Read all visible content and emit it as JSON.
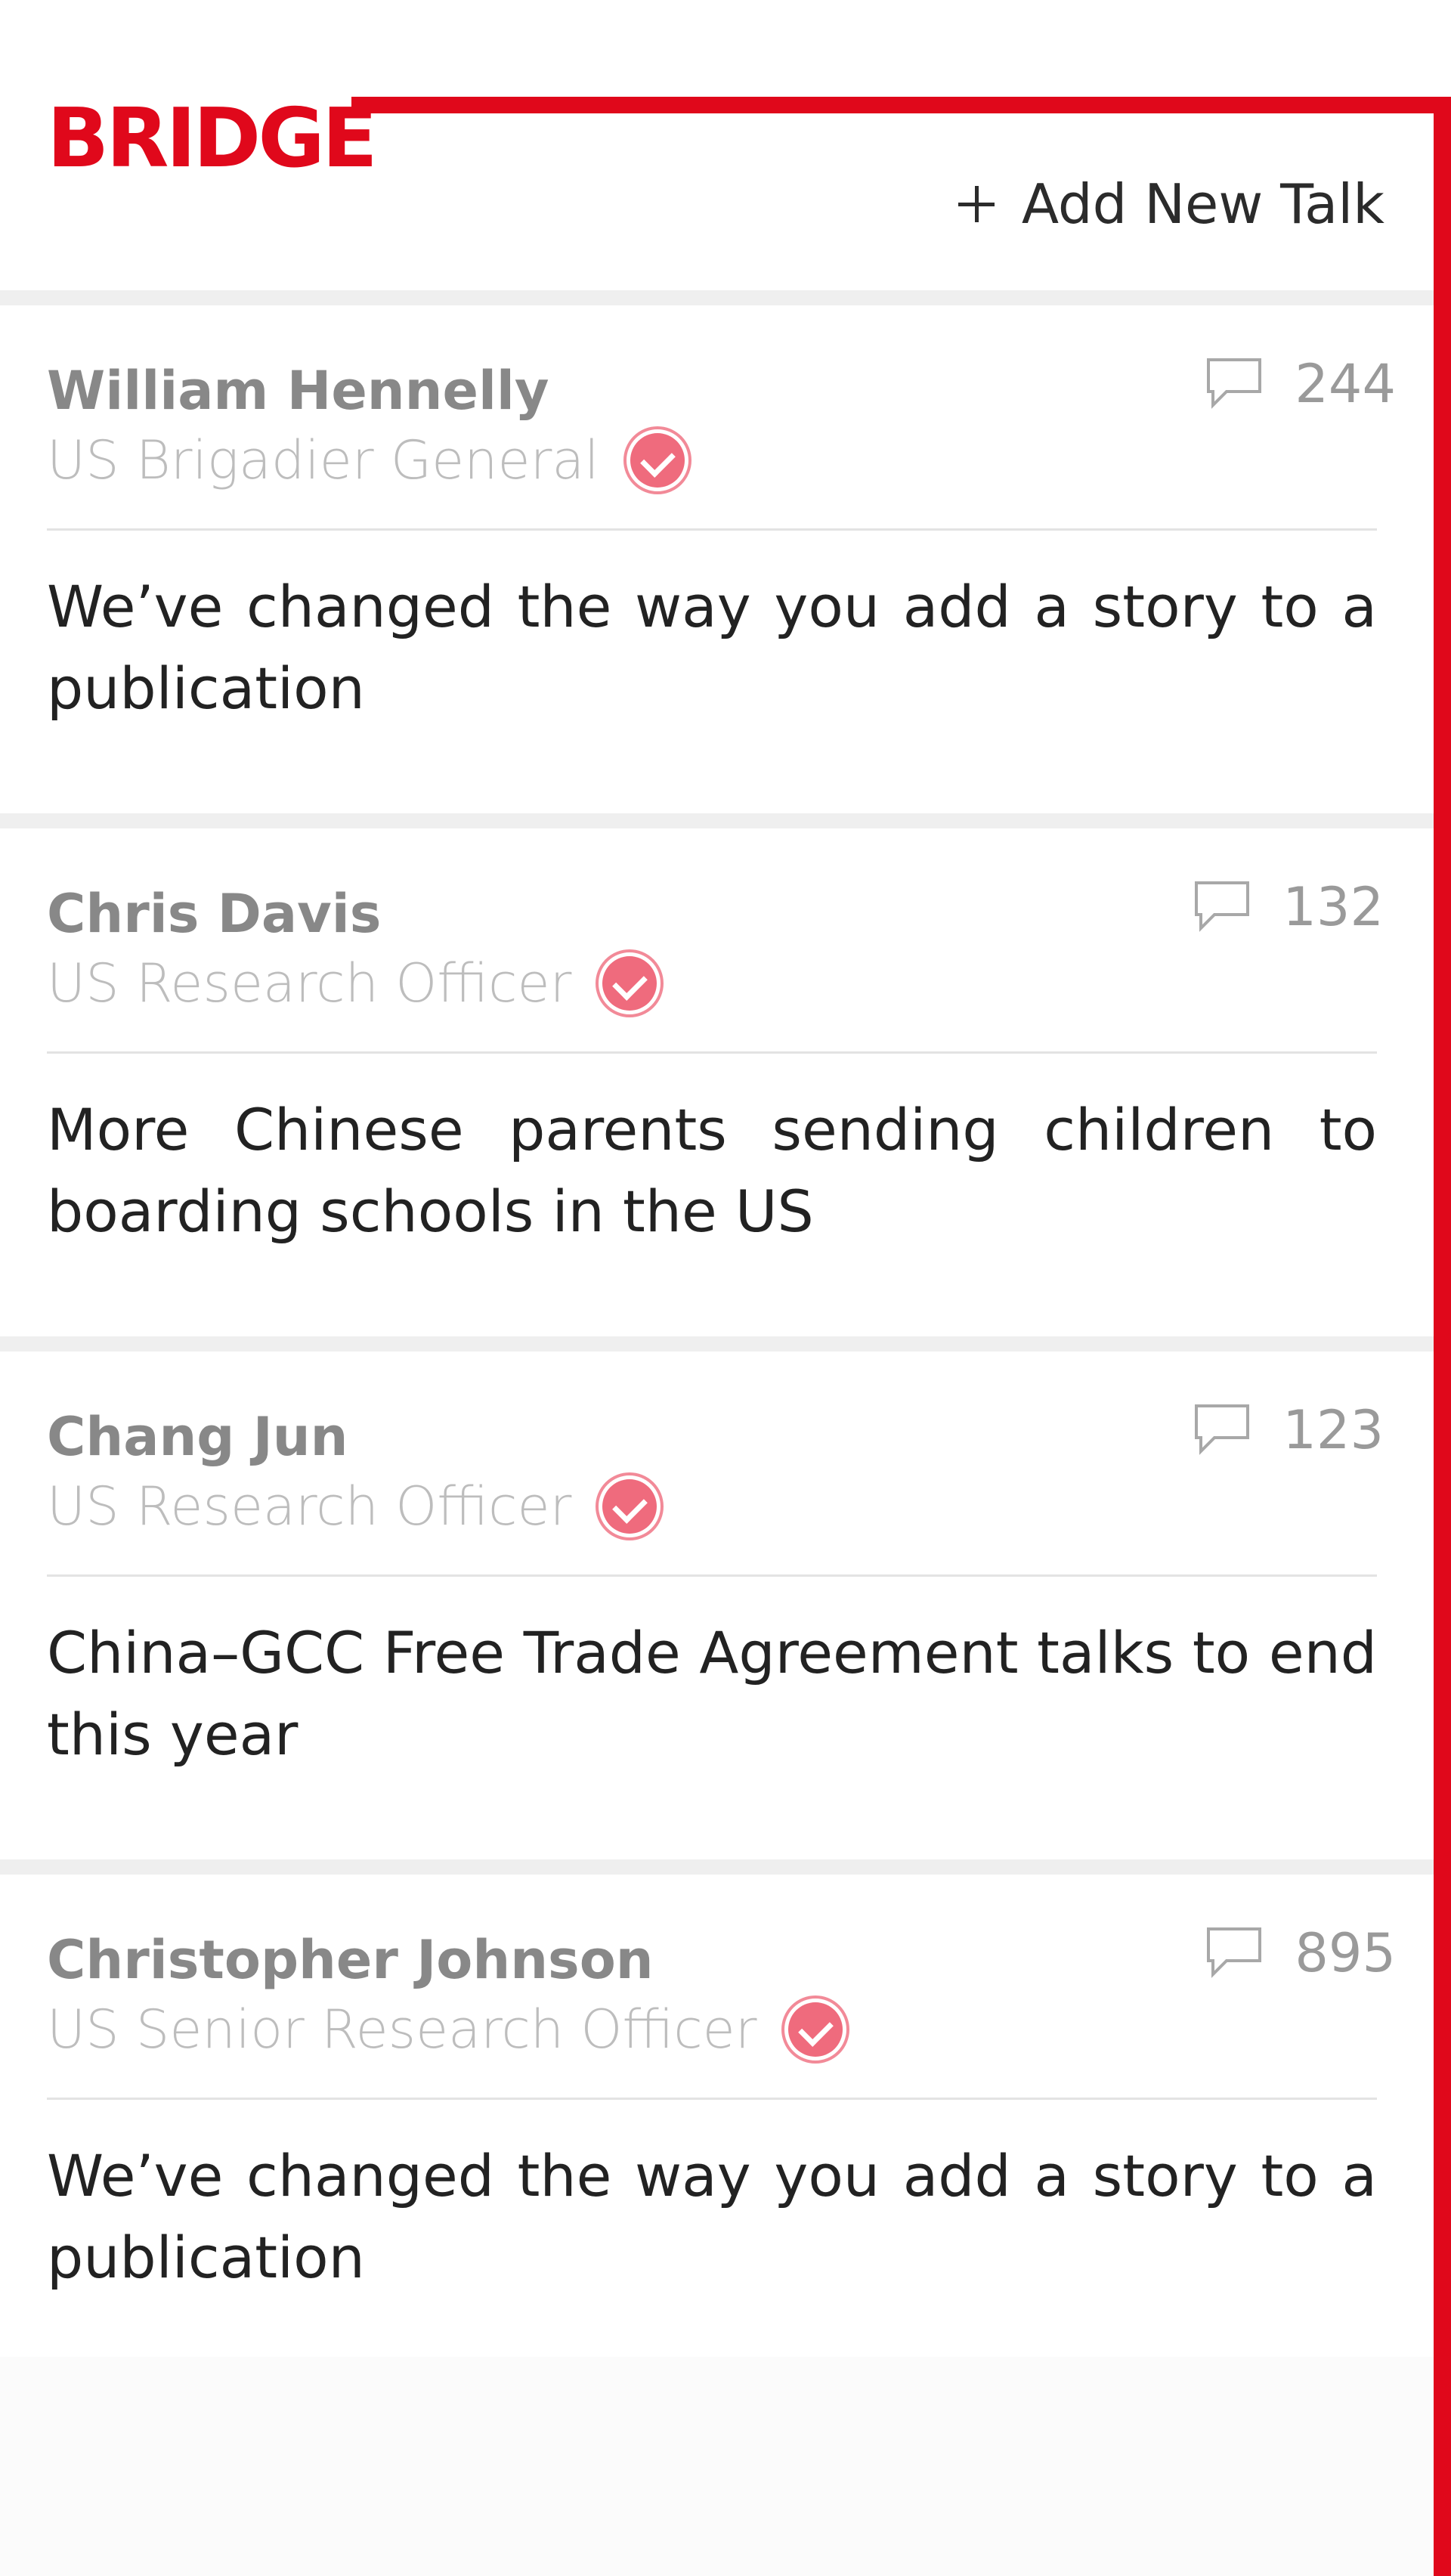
{
  "brand": "BRIDGE",
  "add_button_label": "Add New Talk",
  "colors": {
    "accent": "#E0081B",
    "verified": "#EF6B7D"
  },
  "talks": [
    {
      "author": "William Hennelly",
      "role": "US Brigadier General",
      "verified": true,
      "comments": "244",
      "headline": "We’ve changed the way you add a story to a publication"
    },
    {
      "author": "Chris Davis",
      "role": "US Research Officer",
      "verified": true,
      "comments": "132",
      "headline": "More Chinese parents sending children to boarding schools in the US"
    },
    {
      "author": "Chang Jun",
      "role": "US Research Officer",
      "verified": true,
      "comments": "123",
      "headline": "China–GCC Free Trade Agreement talks to end this year"
    },
    {
      "author": "Christopher Johnson",
      "role": "US Senior Research Officer",
      "verified": true,
      "comments": "895",
      "headline": "We’ve changed the way you add a story to a publication"
    }
  ]
}
